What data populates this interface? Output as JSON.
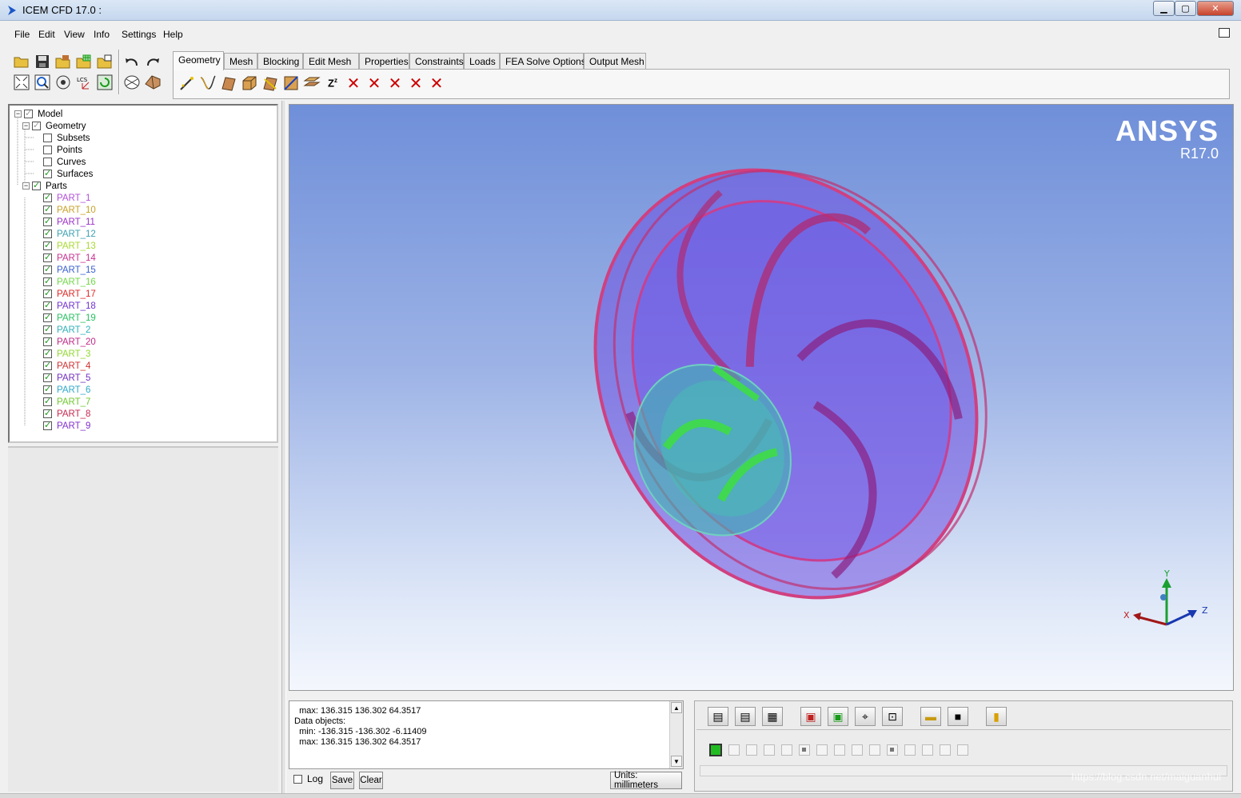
{
  "window": {
    "title": "ICEM CFD 17.0 :",
    "min_icon": "minimize-icon",
    "max_icon": "maximize-icon",
    "close_icon": "close-icon"
  },
  "menu": [
    "File",
    "Edit",
    "View",
    "Info",
    "Settings",
    "Help"
  ],
  "tabs": [
    "Geometry",
    "Mesh",
    "Blocking",
    "Edit Mesh",
    "Properties",
    "Constraints",
    "Loads",
    "FEA Solve Options",
    "Output Mesh"
  ],
  "active_tab": "Geometry",
  "tree": {
    "model": "Model",
    "geometry": "Geometry",
    "geometry_items": [
      {
        "label": "Subsets",
        "checked": false
      },
      {
        "label": "Points",
        "checked": false
      },
      {
        "label": "Curves",
        "checked": false
      },
      {
        "label": "Surfaces",
        "checked": true
      }
    ],
    "parts_label": "Parts",
    "parts": [
      {
        "label": "PART_1",
        "color": "#b050d8"
      },
      {
        "label": "PART_10",
        "color": "#c8a028"
      },
      {
        "label": "PART_11",
        "color": "#9a30c8"
      },
      {
        "label": "PART_12",
        "color": "#3ca0b0"
      },
      {
        "label": "PART_13",
        "color": "#a8d830"
      },
      {
        "label": "PART_14",
        "color": "#c83090"
      },
      {
        "label": "PART_15",
        "color": "#3a60d0"
      },
      {
        "label": "PART_16",
        "color": "#70d848"
      },
      {
        "label": "PART_17",
        "color": "#e02828"
      },
      {
        "label": "PART_18",
        "color": "#7030d0"
      },
      {
        "label": "PART_19",
        "color": "#28c060"
      },
      {
        "label": "PART_2",
        "color": "#30b0b8"
      },
      {
        "label": "PART_20",
        "color": "#c02888"
      },
      {
        "label": "PART_3",
        "color": "#90d830"
      },
      {
        "label": "PART_4",
        "color": "#d03030"
      },
      {
        "label": "PART_5",
        "color": "#7030c0"
      },
      {
        "label": "PART_6",
        "color": "#30a8c8"
      },
      {
        "label": "PART_7",
        "color": "#70c830"
      },
      {
        "label": "PART_8",
        "color": "#c82850"
      },
      {
        "label": "PART_9",
        "color": "#8030d0"
      }
    ]
  },
  "viewport": {
    "brand": "ANSYS",
    "version": "R17.0",
    "axis": {
      "x": "X",
      "y": "Y",
      "z": "Z"
    }
  },
  "messages": [
    "  max: 136.315 136.302 64.3517",
    "Data objects:",
    "  min: -136.315 -136.302 -6.11409",
    "  max: 136.315 136.302 64.3517"
  ],
  "msg_controls": {
    "log": "Log",
    "save": "Save",
    "clear": "Clear",
    "units": "Units: millimeters"
  },
  "watermark": "https://blog.csdn.net/maiguanhui"
}
